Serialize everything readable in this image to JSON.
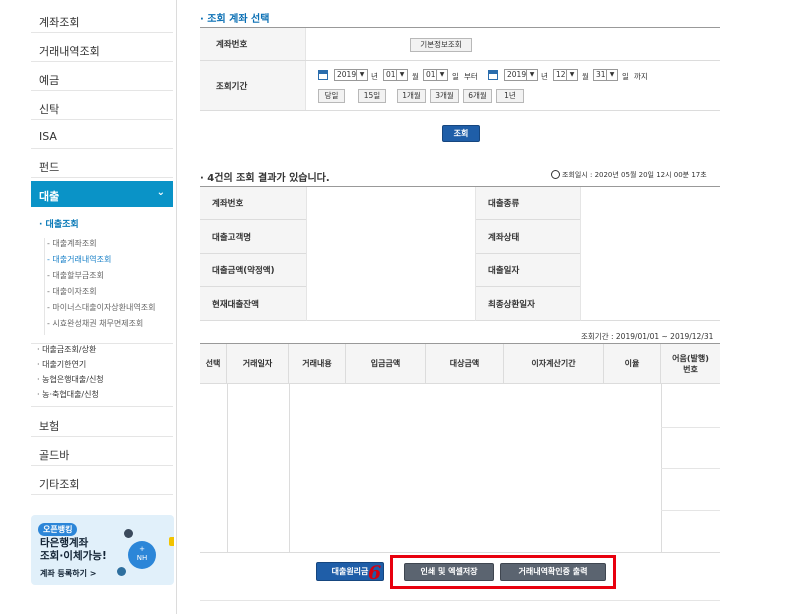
{
  "sidebar": {
    "items_top": [
      "계좌조회",
      "거래내역조회",
      "예금",
      "신탁",
      "ISA",
      "펀드"
    ],
    "active": "대출",
    "sub_title": "· 대출조회",
    "sub_items": [
      {
        "label": "- 대출계좌조회",
        "active": false
      },
      {
        "label": "- 대출거래내역조회",
        "active": true
      },
      {
        "label": "- 대출할부금조회",
        "active": false
      },
      {
        "label": "- 대출이자조회",
        "active": false
      },
      {
        "label": "- 마이너스대출이자상환내역조회",
        "active": false
      },
      {
        "label": "- 시효완성채권 채무면제조회",
        "active": false
      }
    ],
    "links": [
      "· 대출금조회/상환",
      "· 대출기한연기",
      "· 농협은행대출/신청",
      "· 농·축협대출/신청"
    ],
    "items_bottom": [
      "보험",
      "골드바",
      "기타조회"
    ],
    "banner": {
      "tag": "오픈뱅킹",
      "line1": "타은행계좌",
      "line2": "조회·이체가능!",
      "sub": "계좌 등록하기 >",
      "circle_top": "+",
      "circle_bottom": "NH"
    }
  },
  "select_section": {
    "title": "· 조회 계좌 선택",
    "account_label": "계좌번호",
    "info_button": "기본정보조회",
    "period_label": "조회기간",
    "from": {
      "year": "2019",
      "month": "01",
      "day": "01"
    },
    "to": {
      "year": "2019",
      "month": "12",
      "day": "31"
    },
    "unit_year": "년",
    "unit_month": "월",
    "unit_day": "일",
    "from_word": "부터",
    "to_word": "까지",
    "quick": [
      "당일",
      "15일",
      "1개월",
      "3개월",
      "6개월",
      "1년"
    ],
    "search_button": "조회"
  },
  "result_section": {
    "title": "· 4건의 조회 결과가 있습니다.",
    "timestamp": "조회일시 : 2020년 05월 20일 12시 00분 17초",
    "labels_left": [
      "계좌번호",
      "대출고객명",
      "대출금액(약정액)",
      "현재대출잔액"
    ],
    "labels_right": [
      "대출종류",
      "계좌상태",
      "대출일자",
      "최종상환일자"
    ],
    "period": "조회기간 : 2019/01/01 ~ 2019/12/31",
    "columns": [
      "선택",
      "거래일자",
      "거래내용",
      "입금금액",
      "대상금액",
      "이자계산기간",
      "이율",
      "어음(발행)\n번호"
    ]
  },
  "bottom": {
    "btn_loan": "대출원리금",
    "btn_print": "인쇄 및 엑셀저장",
    "btn_cert": "거래내역확인증 출력",
    "annotation": "6"
  },
  "colors": {
    "accent": "#0a93c7",
    "button": "#1f5ea8",
    "highlight": "#e8000e"
  }
}
